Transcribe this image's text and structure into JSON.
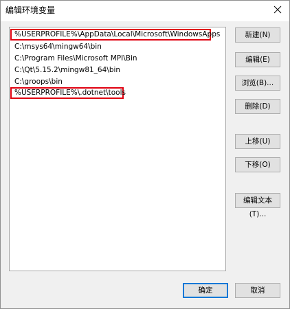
{
  "window": {
    "title": "编辑环境变量",
    "close_glyph": "×"
  },
  "paths": [
    {
      "text": "%USERPROFILE%\\AppData\\Local\\Microsoft\\WindowsApps",
      "highlighted": true
    },
    {
      "text": "C:\\msys64\\mingw64\\bin",
      "highlighted": false
    },
    {
      "text": "C:\\Program Files\\Microsoft MPI\\Bin",
      "highlighted": false
    },
    {
      "text": "C:\\Qt\\5.15.2\\mingw81_64\\bin",
      "highlighted": false
    },
    {
      "text": "C:\\groops\\bin",
      "highlighted": false
    },
    {
      "text": "%USERPROFILE%\\.dotnet\\tools",
      "highlighted": true
    }
  ],
  "buttons": {
    "new": "新建(N)",
    "edit": "编辑(E)",
    "browse": "浏览(B)...",
    "delete": "删除(D)",
    "move_up": "上移(U)",
    "move_down": "下移(O)",
    "edit_text": "编辑文本(T)...",
    "ok": "确定",
    "cancel": "取消"
  },
  "colors": {
    "highlight_border": "#e0000f",
    "default_button_border": "#0078d7"
  }
}
